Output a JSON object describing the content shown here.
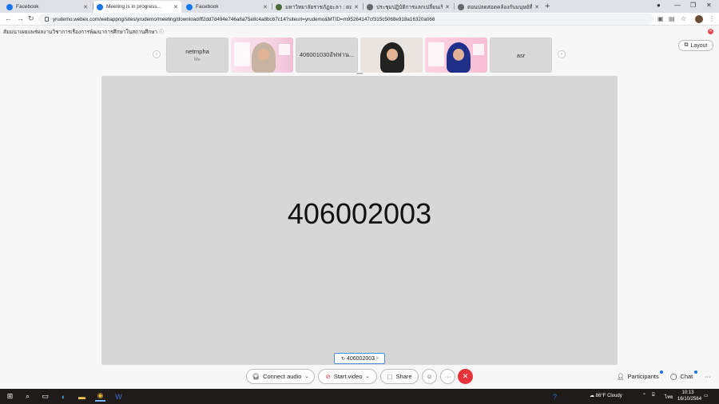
{
  "browser": {
    "tabs": [
      {
        "title": "Facebook",
        "color": "#1877f2"
      },
      {
        "title": "Meeting is in progress...",
        "color": "#1a73e8"
      },
      {
        "title": "Facebook",
        "color": "#1877f2"
      },
      {
        "title": "มหาวิทยาลัยราชภัฏยะลา : ตอนบ่ายของ...",
        "color": "#4b6b3a"
      },
      {
        "title": "ประชุมปฏิบัติการแลกเปลี่ยนเรียนรู้ โคบ...",
        "color": "#555555"
      },
      {
        "title": "ตอนปลดสอดคล้องกับมนุษย์ที่ยกจัดการ...",
        "color": "#555555"
      }
    ],
    "new_tab": "+",
    "url": "yrudemo.webex.com/webappng/sites/yrudemo/meeting/download/ff2dd7d494e746a8a75e8c4a8bcb7c14?siteurl=yrudemo&MTID=m95264147cf315c5068e918a16320a068"
  },
  "meeting": {
    "title": "สัมมนาเผยแพร่ผลงานวิชาการเรื่องการพัฒนาการศึกษาในสถานศึกษา",
    "layout_label": "Layout",
    "participants": [
      {
        "kind": "name",
        "name": "netrnpha",
        "sub": "Me"
      },
      {
        "kind": "video"
      },
      {
        "kind": "name",
        "name": "406001030อัฟฟาน...",
        "sub": ""
      },
      {
        "kind": "video"
      },
      {
        "kind": "video"
      },
      {
        "kind": "name",
        "name": "asr",
        "sub": ""
      }
    ],
    "active_speaker": "406002003",
    "stage_label": "406002003"
  },
  "controls": {
    "connect_audio": "Connect audio",
    "start_video": "Start video",
    "share": "Share",
    "participants": "Participants",
    "chat": "Chat",
    "more": "···"
  },
  "taskbar": {
    "weather": "86°F  Cloudy",
    "lang": "ไทย",
    "time": "10:13",
    "date": "16/10/2564"
  }
}
